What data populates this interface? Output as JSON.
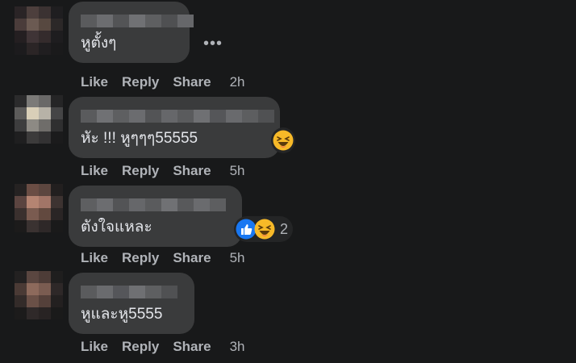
{
  "colors": {
    "background": "#18191a",
    "bubble": "#3a3b3c",
    "text": "#e4e6eb",
    "meta": "#b0b3b8",
    "like_blue": "#1877f2",
    "haha_yellow": "#f7b928"
  },
  "comments": [
    {
      "text": "หูตั้งๆ",
      "actions": {
        "like": "Like",
        "reply": "Reply",
        "share": "Share",
        "time": "2h"
      },
      "more": "•••"
    },
    {
      "text": "หัะ !!! หูๆๆๆ55555",
      "actions": {
        "like": "Like",
        "reply": "Reply",
        "share": "Share",
        "time": "5h"
      },
      "reaction_icon": "haha-emoji-icon"
    },
    {
      "text": "ตังใจแหละ",
      "actions": {
        "like": "Like",
        "reply": "Reply",
        "share": "Share",
        "time": "5h"
      },
      "reaction_icons": [
        "like-reaction-icon",
        "haha-emoji-icon"
      ],
      "reaction_count": "2"
    },
    {
      "text": "หูและหู5555",
      "actions": {
        "like": "Like",
        "reply": "Reply",
        "share": "Share",
        "time": "3h"
      }
    }
  ]
}
